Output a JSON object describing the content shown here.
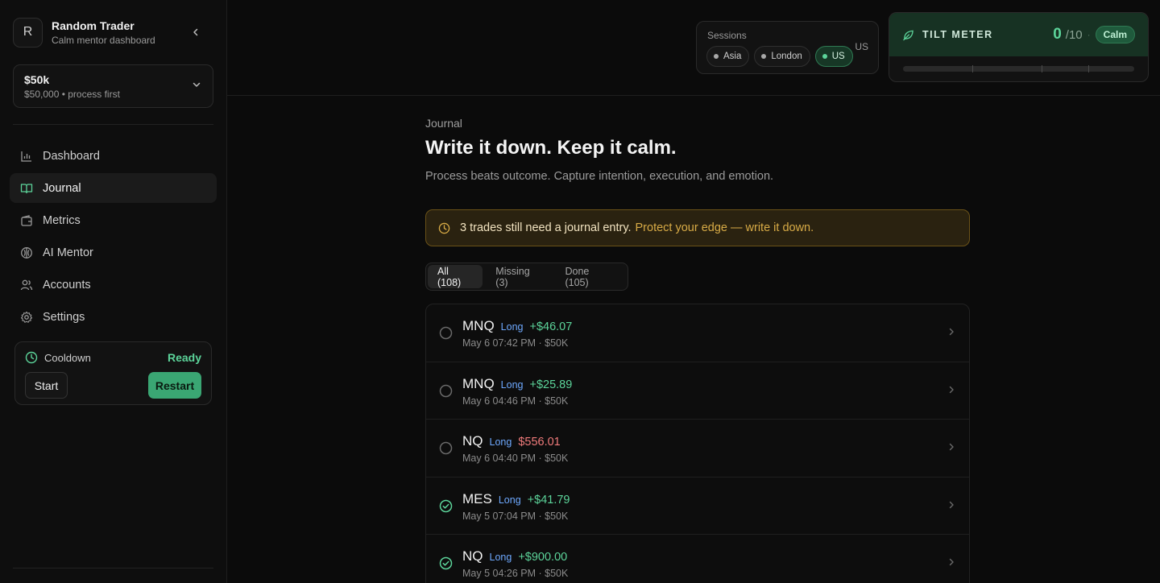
{
  "profile": {
    "initial": "R",
    "name": "Random Trader",
    "subtitle": "Calm mentor dashboard"
  },
  "account": {
    "title": "$50k",
    "subtitle": "$50,000 • process first"
  },
  "nav": [
    {
      "label": "Dashboard",
      "icon": "bar-chart-icon"
    },
    {
      "label": "Journal",
      "icon": "book-icon",
      "active": true
    },
    {
      "label": "Metrics",
      "icon": "wallet-icon"
    },
    {
      "label": "AI Mentor",
      "icon": "brain-icon"
    },
    {
      "label": "Accounts",
      "icon": "users-icon"
    },
    {
      "label": "Settings",
      "icon": "gear-icon"
    }
  ],
  "cooldown": {
    "label": "Cooldown",
    "status": "Ready",
    "start_label": "Start",
    "restart_label": "Restart"
  },
  "sessions": {
    "label": "Sessions",
    "options": [
      "Asia",
      "London",
      "US"
    ],
    "active": "US",
    "current": "US"
  },
  "tilt": {
    "title": "TILT METER",
    "score": "0",
    "max": "/10",
    "separator": "·",
    "status": "Calm",
    "level_fraction": 0
  },
  "page": {
    "crumb": "Journal",
    "title": "Write it down. Keep it calm.",
    "subtitle": "Process beats outcome. Capture intention, execution, and emotion."
  },
  "banner": {
    "strong": "3 trades still need a journal entry.",
    "soft": "Protect your edge — write it down."
  },
  "tabs": [
    "All (108)",
    "Missing (3)",
    "Done (105)"
  ],
  "trades": [
    {
      "symbol": "MNQ",
      "side": "Long",
      "pnl": "+$46.07",
      "pnl_sign": "pos",
      "meta": "May 6 07:42 PM · $50K",
      "journaled": false
    },
    {
      "symbol": "MNQ",
      "side": "Long",
      "pnl": "+$25.89",
      "pnl_sign": "pos",
      "meta": "May 6 04:46 PM · $50K",
      "journaled": false
    },
    {
      "symbol": "NQ",
      "side": "Long",
      "pnl": "$556.01",
      "pnl_sign": "neg",
      "meta": "May 6 04:40 PM · $50K",
      "journaled": false
    },
    {
      "symbol": "MES",
      "side": "Long",
      "pnl": "+$41.79",
      "pnl_sign": "pos",
      "meta": "May 5 07:04 PM · $50K",
      "journaled": true
    },
    {
      "symbol": "NQ",
      "side": "Long",
      "pnl": "+$900.00",
      "pnl_sign": "pos",
      "meta": "May 5 04:26 PM · $50K",
      "journaled": true
    }
  ],
  "colors": {
    "accent": "#5cd49a",
    "negative": "#f07b7b",
    "side": "#6ea9ff",
    "warning": "#d8ab46"
  }
}
